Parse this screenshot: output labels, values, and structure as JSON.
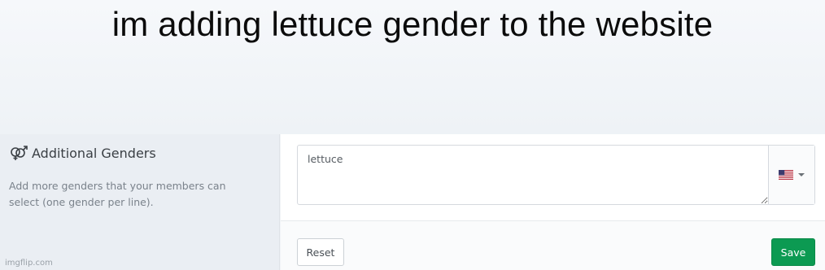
{
  "meme": {
    "caption": "im adding lettuce gender to the website",
    "watermark": "imgflip.com"
  },
  "settings": {
    "section": {
      "icon": "gender-symbols-icon",
      "title": "Additional Genders",
      "description": "Add more genders that your members can select (one gender per line)."
    },
    "genders_input": {
      "value": "lettuce"
    },
    "language_picker": {
      "icon": "us-flag-icon"
    },
    "actions": {
      "reset_label": "Reset",
      "save_label": "Save"
    }
  },
  "colors": {
    "save_button": "#0c9a52",
    "left_panel": "#eaeef3",
    "caption_bg": "#f1f4f7"
  }
}
